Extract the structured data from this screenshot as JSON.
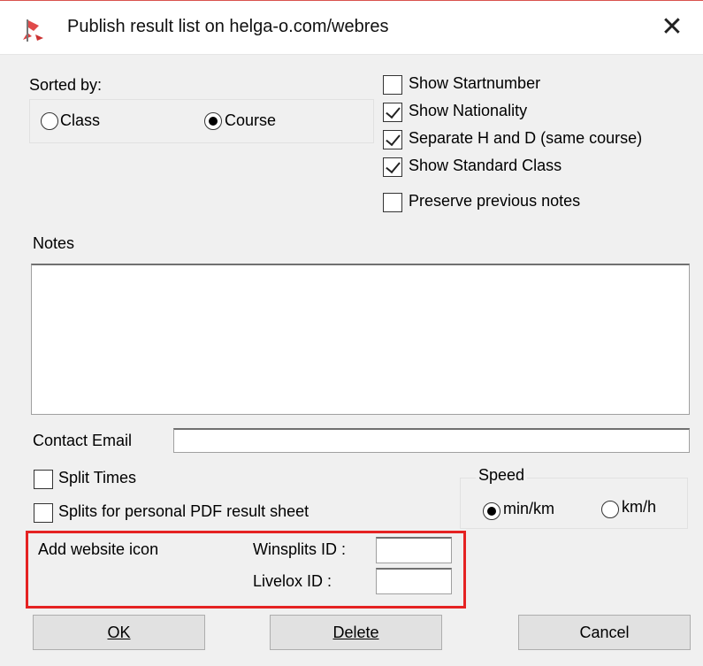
{
  "window": {
    "title": "Publish result list on helga-o.com/webres",
    "close_glyph": "✕",
    "app_icon": "flag-arrow-app-icon",
    "border_accent": "#d9534f"
  },
  "sorted_by": {
    "label": "Sorted by:",
    "options": [
      {
        "label": "Class",
        "selected": false
      },
      {
        "label": "Course",
        "selected": true
      }
    ]
  },
  "options": [
    {
      "label": "Show Startnumber",
      "checked": false
    },
    {
      "label": "Show Nationality",
      "checked": true
    },
    {
      "label": "Separate H and D (same course)",
      "checked": true
    },
    {
      "label": "Show Standard Class",
      "checked": true
    },
    {
      "label": "Preserve previous notes",
      "checked": false
    }
  ],
  "notes": {
    "label": "Notes",
    "value": ""
  },
  "contact_email": {
    "label": "Contact Email",
    "value": ""
  },
  "splits": [
    {
      "label": "Split Times",
      "checked": false
    },
    {
      "label": "Splits for personal PDF result sheet",
      "checked": false
    }
  ],
  "speed": {
    "label": "Speed",
    "options": [
      {
        "label": "min/km",
        "selected": true
      },
      {
        "label": "km/h",
        "selected": false
      }
    ]
  },
  "website": {
    "add_icon_label": "Add website icon",
    "winsplits_label": "Winsplits ID :",
    "winsplits_value": "",
    "livelox_label": "Livelox ID :",
    "livelox_value": "",
    "highlight_color": "#e52222"
  },
  "buttons": {
    "ok_label": "OK",
    "delete_label": "Delete",
    "cancel_label": "Cancel"
  }
}
